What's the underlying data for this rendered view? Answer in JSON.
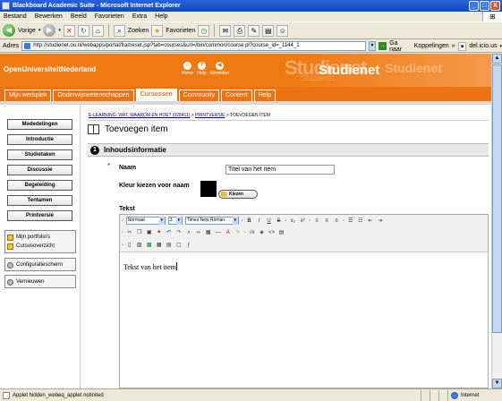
{
  "window": {
    "title": "Blackboard Academic Suite - Microsoft Internet Explorer",
    "minimize": "_",
    "maximize": "□",
    "close": "X"
  },
  "menu": {
    "items": [
      "Bestand",
      "Bewerken",
      "Beeld",
      "Favorieten",
      "Extra",
      "Help"
    ]
  },
  "toolbar": {
    "back_label": "Vorige",
    "search_label": "Zoeken",
    "favorites_label": "Favorieten"
  },
  "address": {
    "label": "Adres",
    "url": "http://studienet.ou.nl/webapps/portal/frameset.jsp?tab=courses&url=/bin/common/course.pl?course_id=_1144_1",
    "go_label": "Ga naar",
    "links_label": "Koppelingen",
    "bookmark_label": "del.icio.us"
  },
  "site": {
    "logo": "OpenUniversiteitNederland",
    "brand": "Studienet",
    "top_icons": [
      {
        "label": "Home",
        "icon": "home-icon",
        "glyph": "⌂"
      },
      {
        "label": "Help",
        "icon": "help-icon",
        "glyph": "?"
      },
      {
        "label": "Afmelden",
        "icon": "logout-icon",
        "glyph": "◀"
      }
    ],
    "tabs": [
      {
        "label": "Mijn werkplek",
        "active": false
      },
      {
        "label": "Onderwijswetenschappen",
        "active": false
      },
      {
        "label": "Cursussen",
        "active": true
      },
      {
        "label": "Community",
        "active": false
      },
      {
        "label": "Content",
        "active": false
      },
      {
        "label": "Help",
        "active": false
      }
    ]
  },
  "leftnav": {
    "buttons": [
      "Mededelingen",
      "Introductie",
      "Studietaken",
      "Discussie",
      "Begeleiding",
      "Tentamen",
      "Printversie"
    ],
    "tools": [
      {
        "label": "Mijn portfolio's",
        "icon": "portfolio-icon"
      },
      {
        "label": "Cursusoverzicht",
        "icon": "course-overview-icon"
      }
    ],
    "config": {
      "label": "Configuratiescherm",
      "icon": "control-panel-icon"
    },
    "refresh": {
      "label": "Vernieuwen",
      "icon": "refresh-icon"
    }
  },
  "content": {
    "breadcrumb": {
      "part1": "E-LEARNING: WAT, WAAROM EN HOE? (028411)",
      "sep": " > ",
      "part2": "PRINTVERSIE",
      "part3": "TOEVOEGEN ITEM"
    },
    "page_title": "Toevoegen item",
    "section": {
      "number": "1",
      "title": "Inhoudsinformatie"
    },
    "required_mark": "*",
    "name_label": "Naam",
    "name_value": "Titel van het item",
    "color_label": "Kleur kiezen voor naam",
    "color_value": "#000000",
    "choose_button": "Kiezen",
    "text_label": "Tekst",
    "editor": {
      "format": "Normaal",
      "size": "3",
      "font": "Times New Roman",
      "body": "Tekst van het item"
    }
  },
  "status": {
    "text": "Applet hidden_webeq_applet notinited",
    "zone": "Internet"
  }
}
